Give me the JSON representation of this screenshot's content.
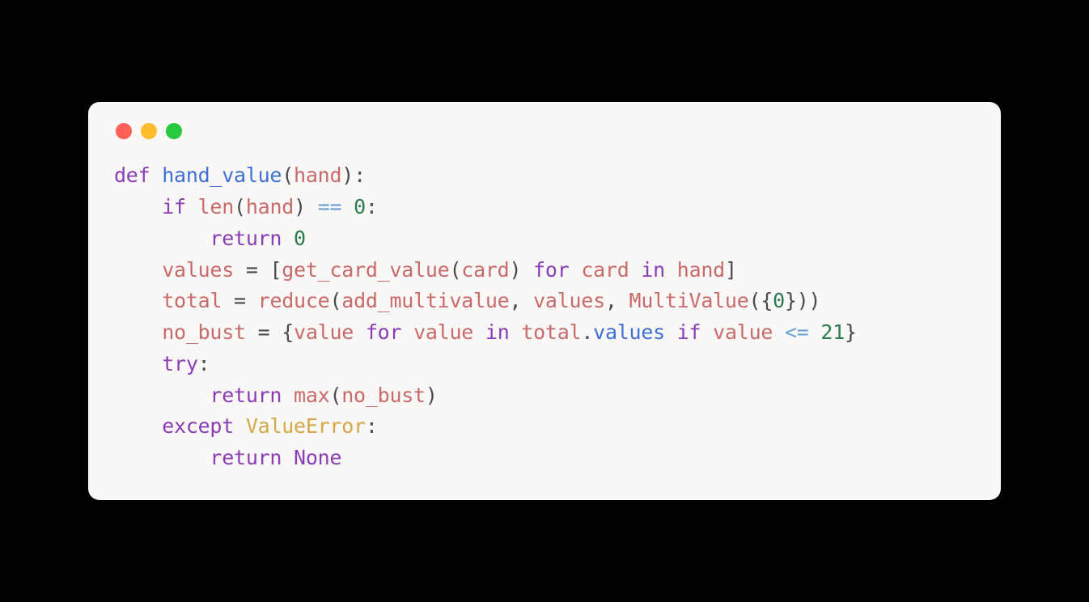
{
  "window": {
    "traffic_lights": [
      "close",
      "minimize",
      "zoom"
    ]
  },
  "code": {
    "tokens": [
      {
        "t": "def ",
        "c": "kw"
      },
      {
        "t": "hand_value",
        "c": "fn"
      },
      {
        "t": "(",
        "c": "punc"
      },
      {
        "t": "hand",
        "c": "name"
      },
      {
        "t": "):",
        "c": "punc"
      },
      {
        "t": "\n    ",
        "c": "punc"
      },
      {
        "t": "if ",
        "c": "kw"
      },
      {
        "t": "len",
        "c": "name"
      },
      {
        "t": "(",
        "c": "punc"
      },
      {
        "t": "hand",
        "c": "name"
      },
      {
        "t": ") ",
        "c": "punc"
      },
      {
        "t": "== ",
        "c": "op"
      },
      {
        "t": "0",
        "c": "num"
      },
      {
        "t": ":",
        "c": "punc"
      },
      {
        "t": "\n        ",
        "c": "punc"
      },
      {
        "t": "return ",
        "c": "kw"
      },
      {
        "t": "0",
        "c": "num"
      },
      {
        "t": "\n    ",
        "c": "punc"
      },
      {
        "t": "values",
        "c": "name"
      },
      {
        "t": " = ",
        "c": "punc"
      },
      {
        "t": "[",
        "c": "punc"
      },
      {
        "t": "get_card_value",
        "c": "name"
      },
      {
        "t": "(",
        "c": "punc"
      },
      {
        "t": "card",
        "c": "name"
      },
      {
        "t": ")",
        "c": "punc"
      },
      {
        "t": " for ",
        "c": "kw"
      },
      {
        "t": "card",
        "c": "name"
      },
      {
        "t": " in ",
        "c": "kw"
      },
      {
        "t": "hand",
        "c": "name"
      },
      {
        "t": "]",
        "c": "punc"
      },
      {
        "t": "\n    ",
        "c": "punc"
      },
      {
        "t": "total",
        "c": "name"
      },
      {
        "t": " = ",
        "c": "punc"
      },
      {
        "t": "reduce",
        "c": "name"
      },
      {
        "t": "(",
        "c": "punc"
      },
      {
        "t": "add_multivalue",
        "c": "name"
      },
      {
        "t": ", ",
        "c": "punc"
      },
      {
        "t": "values",
        "c": "name"
      },
      {
        "t": ", ",
        "c": "punc"
      },
      {
        "t": "MultiValue",
        "c": "name"
      },
      {
        "t": "({",
        "c": "punc"
      },
      {
        "t": "0",
        "c": "num"
      },
      {
        "t": "}))",
        "c": "punc"
      },
      {
        "t": "\n    ",
        "c": "punc"
      },
      {
        "t": "no_bust",
        "c": "name"
      },
      {
        "t": " = ",
        "c": "punc"
      },
      {
        "t": "{",
        "c": "punc"
      },
      {
        "t": "value",
        "c": "name"
      },
      {
        "t": " for ",
        "c": "kw"
      },
      {
        "t": "value",
        "c": "name"
      },
      {
        "t": " in ",
        "c": "kw"
      },
      {
        "t": "total",
        "c": "name"
      },
      {
        "t": ".",
        "c": "punc"
      },
      {
        "t": "values",
        "c": "fn"
      },
      {
        "t": " if ",
        "c": "kw"
      },
      {
        "t": "value",
        "c": "name"
      },
      {
        "t": " <= ",
        "c": "op"
      },
      {
        "t": "21",
        "c": "num"
      },
      {
        "t": "}",
        "c": "punc"
      },
      {
        "t": "\n    ",
        "c": "punc"
      },
      {
        "t": "try",
        "c": "kw"
      },
      {
        "t": ":",
        "c": "punc"
      },
      {
        "t": "\n        ",
        "c": "punc"
      },
      {
        "t": "return ",
        "c": "kw"
      },
      {
        "t": "max",
        "c": "name"
      },
      {
        "t": "(",
        "c": "punc"
      },
      {
        "t": "no_bust",
        "c": "name"
      },
      {
        "t": ")",
        "c": "punc"
      },
      {
        "t": "\n    ",
        "c": "punc"
      },
      {
        "t": "except ",
        "c": "kw"
      },
      {
        "t": "ValueError",
        "c": "classname"
      },
      {
        "t": ":",
        "c": "punc"
      },
      {
        "t": "\n        ",
        "c": "punc"
      },
      {
        "t": "return ",
        "c": "kw"
      },
      {
        "t": "None",
        "c": "none"
      }
    ]
  }
}
